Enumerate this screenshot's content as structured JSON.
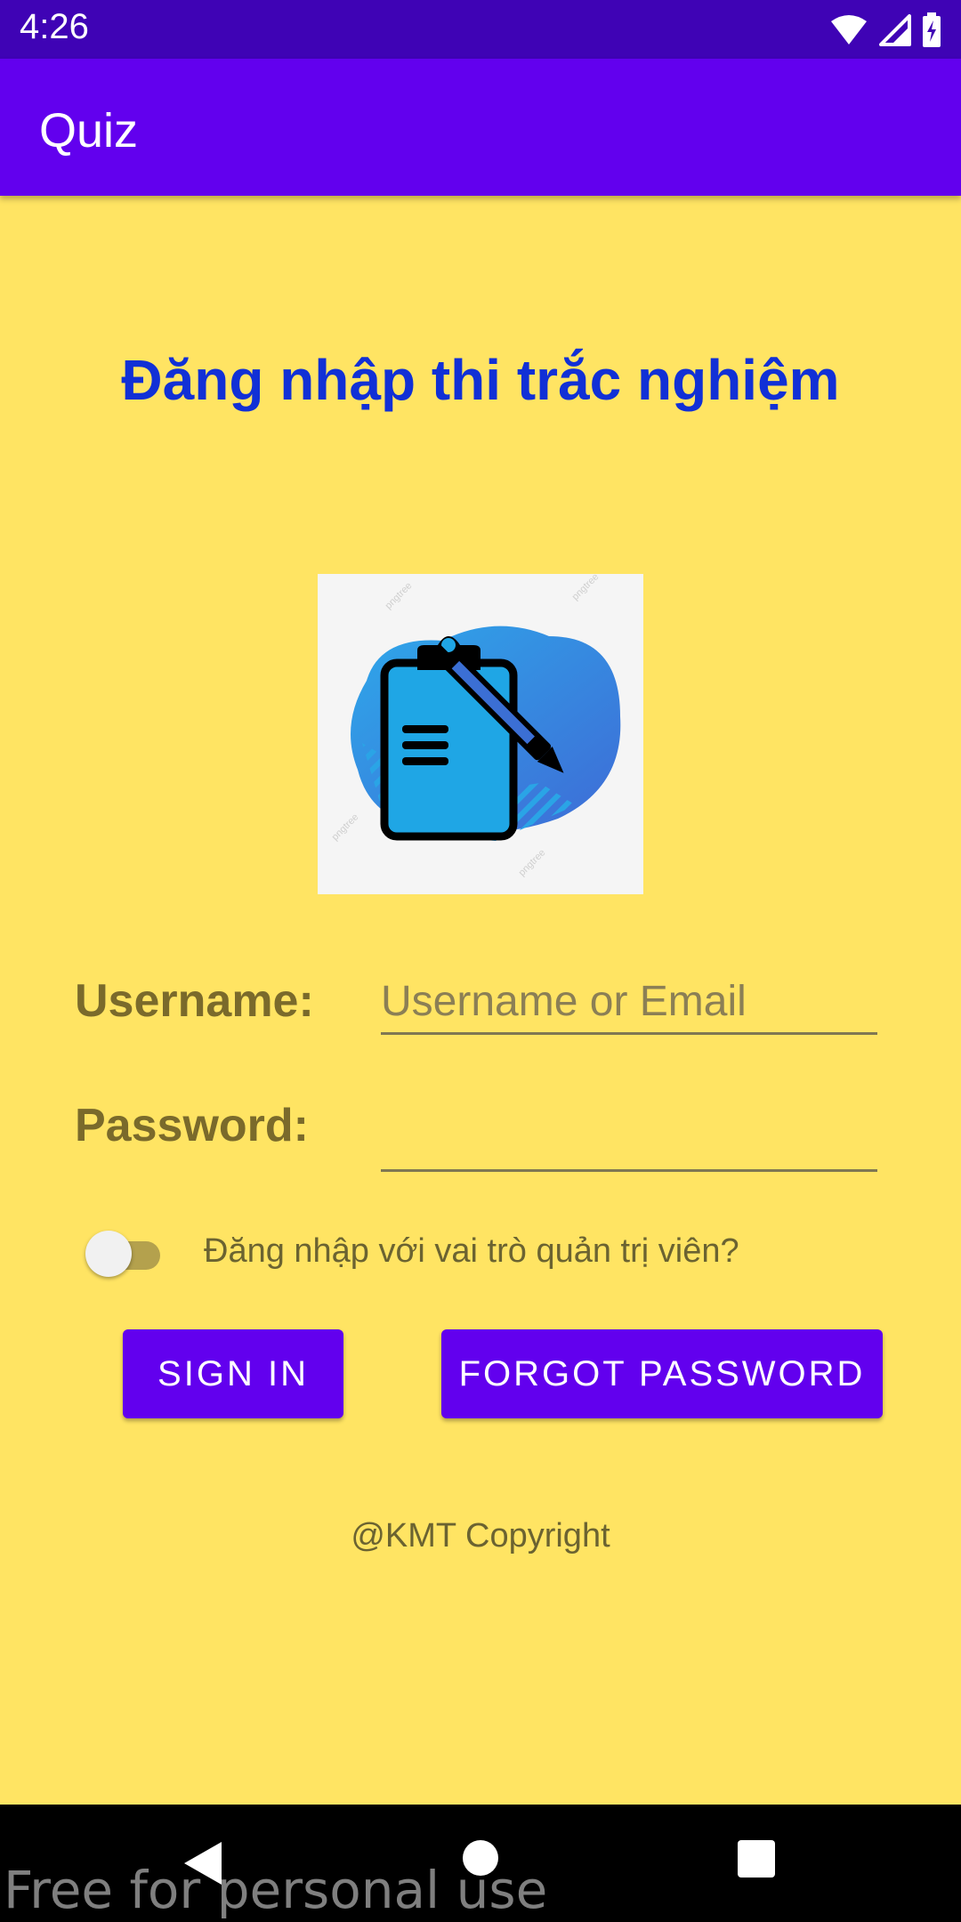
{
  "status_bar": {
    "time": "4:26",
    "icons": [
      "wifi-icon",
      "signal-icon",
      "battery-icon"
    ]
  },
  "app_bar": {
    "title": "Quiz"
  },
  "main": {
    "title": "Đăng nhập thi trắc nghiệm",
    "logo": {
      "icon": "clipboard-pen-icon",
      "watermark": "pngtree"
    },
    "username": {
      "label": "Username:",
      "placeholder": "Username or Email",
      "value": ""
    },
    "password": {
      "label": "Password:",
      "placeholder": "",
      "value": ""
    },
    "admin_toggle": {
      "label": "Đăng nhập với vai trò quản trị viên?",
      "checked": false
    },
    "sign_in_label": "SIGN IN",
    "forgot_password_label": "FORGOT PASSWORD",
    "copyright": "@KMT Copyright"
  },
  "nav_bar": {
    "buttons": [
      "back-icon",
      "home-icon",
      "recents-icon"
    ]
  },
  "watermark": "Free for personal use",
  "colors": {
    "background": "#FFE463",
    "app_bar": "#6200EE",
    "status_bar": "#3F03B5",
    "title": "#1130D6",
    "button": "#6200EE"
  }
}
